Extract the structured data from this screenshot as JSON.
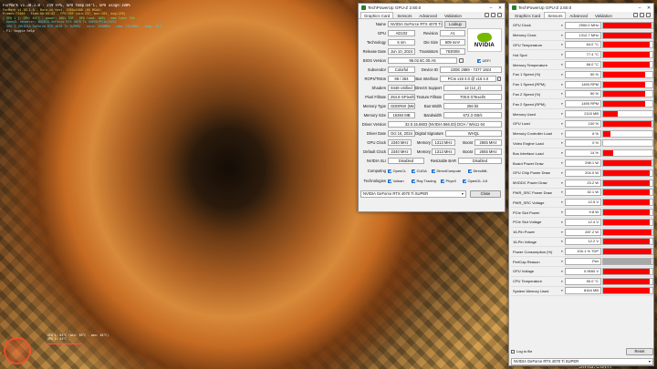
{
  "furmark": {
    "title_line": "FurMark v1.38.1.0 - 259 FPS, GPU temp:64°C, GPU usage:100%",
    "hud_lines": [
      {
        "text": "FurMark v1.38.1.0 - Burn-in test, 1920x1080 (0X MSAA)",
        "color": "c-y"
      },
      {
        "text": "Frames:73405 - time:00:04:43 - FPS:259 (min:237, max:265, avg:259)",
        "color": "c-y"
      },
      {
        "text": "[ GPU 1 ]: GPU: 64°C - power: 100% TDP - GPU load: 100% - mem load: 10% ...",
        "color": "c-g"
      },
      {
        "text": "- OpenGL renderer: NVIDIA GeForce RTX 4070 Ti SUPER/PCIe/SSE2",
        "color": "c-c"
      },
      {
        "text": "- GPU 1 (NVIDIA GeForce RTX 4070 Ti SUPER) - core: 2550MHz - mem: 1312MHz - temp: 64°C ...",
        "color": "c-c"
      },
      {
        "text": "- F1: toggle help",
        "color": "c-w"
      }
    ],
    "graph_caption_1": "GPU 1: 64°C (min: 36°C - max: 64°C)",
    "graph_caption_2": "GPU 1: 64°C"
  },
  "watermark": {
    "line1": "新 浪",
    "line2": "众 测",
    "sub": "sina.com"
  },
  "gpuz_card": {
    "window_title": "TechPowerUp GPU-Z 2.60.0",
    "tabs": [
      "Graphics Card",
      "Sensors",
      "Advanced",
      "Validation"
    ],
    "lookup_button": "Lookup",
    "uefi_label": "UEFI",
    "fields": {
      "name": {
        "label": "Name",
        "value": "NVIDIA GeForce RTX 4070 Ti SUPER"
      },
      "gpu": {
        "label": "GPU",
        "value": "AD102"
      },
      "revision": {
        "label": "Revision",
        "value": "A1"
      },
      "technology": {
        "label": "Technology",
        "value": "5 nm"
      },
      "die_size": {
        "label": "Die Size",
        "value": "609 mm²"
      },
      "release_date": {
        "label": "Release Date",
        "value": "Jun 10, 2024"
      },
      "transistors": {
        "label": "Transistors",
        "value": "76300M"
      },
      "bios": {
        "label": "BIOS Version",
        "value": "95.02.6C.00.A5"
      },
      "subvendor": {
        "label": "Subvendor",
        "value": "Colorful"
      },
      "device_id": {
        "label": "Device ID",
        "value": "10DE 2689 - 7377 1924"
      },
      "rops": {
        "label": "ROPs/TMUs",
        "value": "96 / 264"
      },
      "bus_interface": {
        "label": "Bus Interface",
        "value": "PCIe x16 4.0 @ x16 4.0"
      },
      "shaders": {
        "label": "Shaders",
        "value": "8448 Unified"
      },
      "directx": {
        "label": "DirectX Support",
        "value": "12 (12_2)"
      },
      "pixel_fillrate": {
        "label": "Pixel Fillrate",
        "value": "254.8 GPixel/s"
      },
      "texture_fillrate": {
        "label": "Texture Fillrate",
        "value": "700.8 GTexel/s"
      },
      "memory_type": {
        "label": "Memory Type",
        "value": "GDDR6X (Micron)"
      },
      "bus_width": {
        "label": "Bus Width",
        "value": "256 bit"
      },
      "memory_size": {
        "label": "Memory Size",
        "value": "16384 MB"
      },
      "bandwidth": {
        "label": "Bandwidth",
        "value": "672.3 GB/s"
      },
      "driver_version": {
        "label": "Driver Version",
        "value": "32.0.15.6603 (NVIDIA 566.03) DCH / Win11 64"
      },
      "driver_date": {
        "label": "Driver Date",
        "value": "Oct 15, 2024"
      },
      "digital_signature": {
        "label": "Digital Signature",
        "value": "WHQL"
      },
      "gpu_clock": {
        "label": "GPU Clock",
        "value": "2340 MHz"
      },
      "memory_clock": {
        "label": "Memory",
        "value": "1313 MHz"
      },
      "boost_clock": {
        "label": "Boost",
        "value": "2655 MHz"
      },
      "default_clock": {
        "label": "Default Clock",
        "value": "2340 MHz"
      },
      "default_memory": {
        "label": "Memory",
        "value": "1313 MHz"
      },
      "default_boost": {
        "label": "Boost",
        "value": "2655 MHz"
      },
      "nvidia_sli": {
        "label": "NVIDIA SLI",
        "value": "Disabled"
      },
      "resizable_bar": {
        "label": "Resizable BAR",
        "value": "Disabled"
      }
    },
    "computing_label": "Computing",
    "computing": [
      "OpenCL",
      "CUDA",
      "DirectCompute",
      "DirectML"
    ],
    "technologies_label": "Technologies",
    "technologies": [
      "Vulkan",
      "Ray Tracing",
      "PhysX",
      "OpenGL 4.6"
    ],
    "selected_gpu": "NVIDIA GeForce RTX 4070 Ti SUPER",
    "close_button": "Close"
  },
  "gpuz_sensors": {
    "window_title": "TechPowerUp GPU-Z 2.60.0",
    "tabs": [
      "Graphics Card",
      "Sensors",
      "Advanced",
      "Validation"
    ],
    "sensors": [
      {
        "name": "GPU Clock",
        "value": "2550.0 MHz",
        "level": 0.98
      },
      {
        "name": "Memory Clock",
        "value": "1312.7 MHz",
        "level": 0.98
      },
      {
        "name": "GPU Temperature",
        "value": "64.0 °C",
        "level": 0.95
      },
      {
        "name": "Hot Spot",
        "value": "77.4 °C",
        "level": 0.95
      },
      {
        "name": "Memory Temperature",
        "value": "66.0 °C",
        "level": 0.95
      },
      {
        "name": "Fan 1 Speed (%)",
        "value": "50 %",
        "level": 0.85
      },
      {
        "name": "Fan 1 Speed (RPM)",
        "value": "1490 RPM",
        "level": 0.85
      },
      {
        "name": "Fan 2 Speed (%)",
        "value": "50 %",
        "level": 0.85
      },
      {
        "name": "Fan 2 Speed (RPM)",
        "value": "1490 RPM",
        "level": 0.85
      },
      {
        "name": "Memory Used",
        "value": "2115 MB",
        "level": 0.3
      },
      {
        "name": "GPU Load",
        "value": "100 %",
        "level": 0.98
      },
      {
        "name": "Memory Controller Load",
        "value": "6 %",
        "level": 0.15
      },
      {
        "name": "Video Engine Load",
        "value": "0 %",
        "level": 0.0
      },
      {
        "name": "Bus Interface Load",
        "value": "14 %",
        "level": 0.2
      },
      {
        "name": "Board Power Draw",
        "value": "298.1 W",
        "level": 0.98
      },
      {
        "name": "GPU Chip Power Draw",
        "value": "204.0 W",
        "level": 0.95
      },
      {
        "name": "MVDDC Power Draw",
        "value": "23.2 W",
        "level": 0.95
      },
      {
        "name": "PWR_SRC Power Draw",
        "value": "32.1 W",
        "level": 0.95
      },
      {
        "name": "PWR_SRC Voltage",
        "value": "12.5 V",
        "level": 0.95
      },
      {
        "name": "PCIe Slot Power",
        "value": "9.8 W",
        "level": 0.95
      },
      {
        "name": "PCIe Slot Voltage",
        "value": "12.4 V",
        "level": 0.95
      },
      {
        "name": "16-Pin Power",
        "value": "287.2 W",
        "level": 0.98
      },
      {
        "name": "16-Pin Voltage",
        "value": "12.2 V",
        "level": 0.95
      },
      {
        "name": "Power Consumption (%)",
        "value": "100.1 % TDP",
        "level": 0.98
      },
      {
        "name": "PerfCap Reason",
        "value": "Pwr",
        "level": 0.98,
        "perfcap": true
      },
      {
        "name": "GPU Voltage",
        "value": "0.9550 V",
        "level": 0.95
      },
      {
        "name": "CPU Temperature",
        "value": "50.0 °C",
        "level": 0.95
      },
      {
        "name": "System Memory Used",
        "value": "8164 MB",
        "level": 0.95
      }
    ],
    "log_to_file_label": "Log to file",
    "reset_button": "Reset",
    "selected_gpu": "NVIDIA GeForce RTX 4070 Ti SUPER",
    "graph_color": "#ff0000",
    "perfcap_color": "#a8a8a8"
  }
}
